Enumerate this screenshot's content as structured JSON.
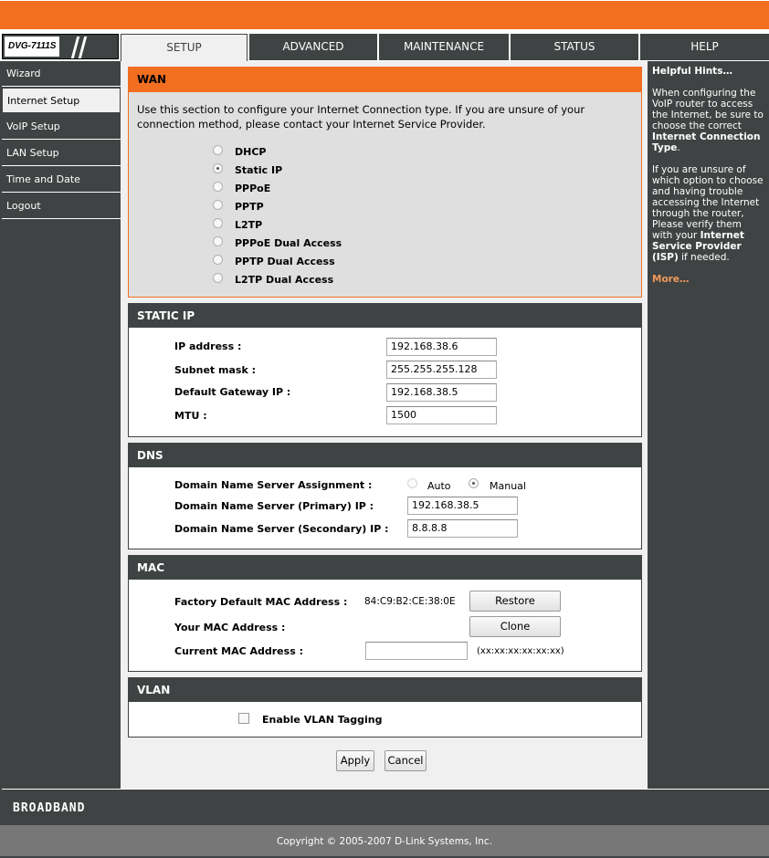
{
  "brand": {
    "model": "DVG-7111S",
    "footer_logo": "BROADBAND",
    "copyright": "Copyright © 2005-2007 D-Link Systems, Inc."
  },
  "tabs": [
    {
      "label": "SETUP",
      "active": true
    },
    {
      "label": "ADVANCED"
    },
    {
      "label": "MAINTENANCE"
    },
    {
      "label": "STATUS"
    },
    {
      "label": "HELP"
    }
  ],
  "sidebar": [
    {
      "label": "Wizard"
    },
    {
      "label": "Internet Setup",
      "active": true
    },
    {
      "label": "VoIP Setup"
    },
    {
      "label": "LAN Setup"
    },
    {
      "label": "Time and Date"
    },
    {
      "label": "Logout"
    }
  ],
  "wan": {
    "title": "WAN",
    "description": "Use this section to configure your Internet Connection type. If you are unsure of your connection method, please contact your Internet Service Provider.",
    "options": [
      "DHCP",
      "Static IP",
      "PPPoE",
      "PPTP",
      "L2TP",
      "PPPoE Dual Access",
      "PPTP Dual Access",
      "L2TP Dual Access"
    ],
    "selected": "Static IP"
  },
  "static_ip": {
    "title": "STATIC IP",
    "ip_label": "IP address :",
    "ip": "192.168.38.6",
    "mask_label": "Subnet mask :",
    "mask": "255.255.255.128",
    "gw_label": "Default Gateway IP :",
    "gw": "192.168.38.5",
    "mtu_label": "MTU :",
    "mtu": "1500"
  },
  "dns": {
    "title": "DNS",
    "assign_label": "Domain Name Server Assignment :",
    "auto": "Auto",
    "manual": "Manual",
    "selected": "Manual",
    "primary_label": "Domain Name Server (Primary) IP :",
    "primary": "192.168.38.5",
    "secondary_label": "Domain Name Server (Secondary) IP :",
    "secondary": "8.8.8.8"
  },
  "mac": {
    "title": "MAC",
    "factory_label": "Factory Default MAC Address :",
    "factory": "84:C9:B2:CE:38:0E",
    "restore": "Restore",
    "your_label": "Your MAC Address :",
    "clone": "Clone",
    "current_label": "Current MAC Address :",
    "current": "",
    "format_hint": "(xx:xx:xx:xx:xx:xx)"
  },
  "vlan": {
    "title": "VLAN",
    "enable_label": "Enable VLAN Tagging",
    "enabled": false
  },
  "actions": {
    "apply": "Apply",
    "cancel": "Cancel"
  },
  "hints": {
    "title": "Helpful Hints…",
    "p1_a": "When configuring the VoIP router to access the Internet, be sure to choose the correct ",
    "p1_b": "Internet Connection Type",
    "p1_c": ".",
    "p2_a": "If you are unsure of which option to choose and having trouble accessing the Internet through the router, Please verify them with your ",
    "p2_b": "Internet Service Provider (ISP)",
    "p2_c": " if needed.",
    "more": "More…"
  },
  "colors": {
    "orange": "#f26e21",
    "dark": "#404343"
  }
}
